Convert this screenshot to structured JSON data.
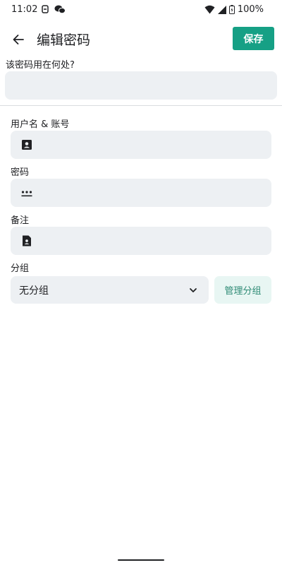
{
  "status_bar": {
    "time": "11:02",
    "battery": "100%"
  },
  "header": {
    "title": "编辑密码",
    "save_label": "保存"
  },
  "form": {
    "usage_label": "该密码用在何处?",
    "username_label": "用户名 & 账号",
    "password_label": "密码",
    "note_label": "备注",
    "group_label": "分组",
    "group_value": "无分组",
    "manage_group_label": "管理分组"
  },
  "colors": {
    "accent": "#16a085",
    "field_background": "#edf0f3",
    "manage_background": "#e8f6f3"
  }
}
